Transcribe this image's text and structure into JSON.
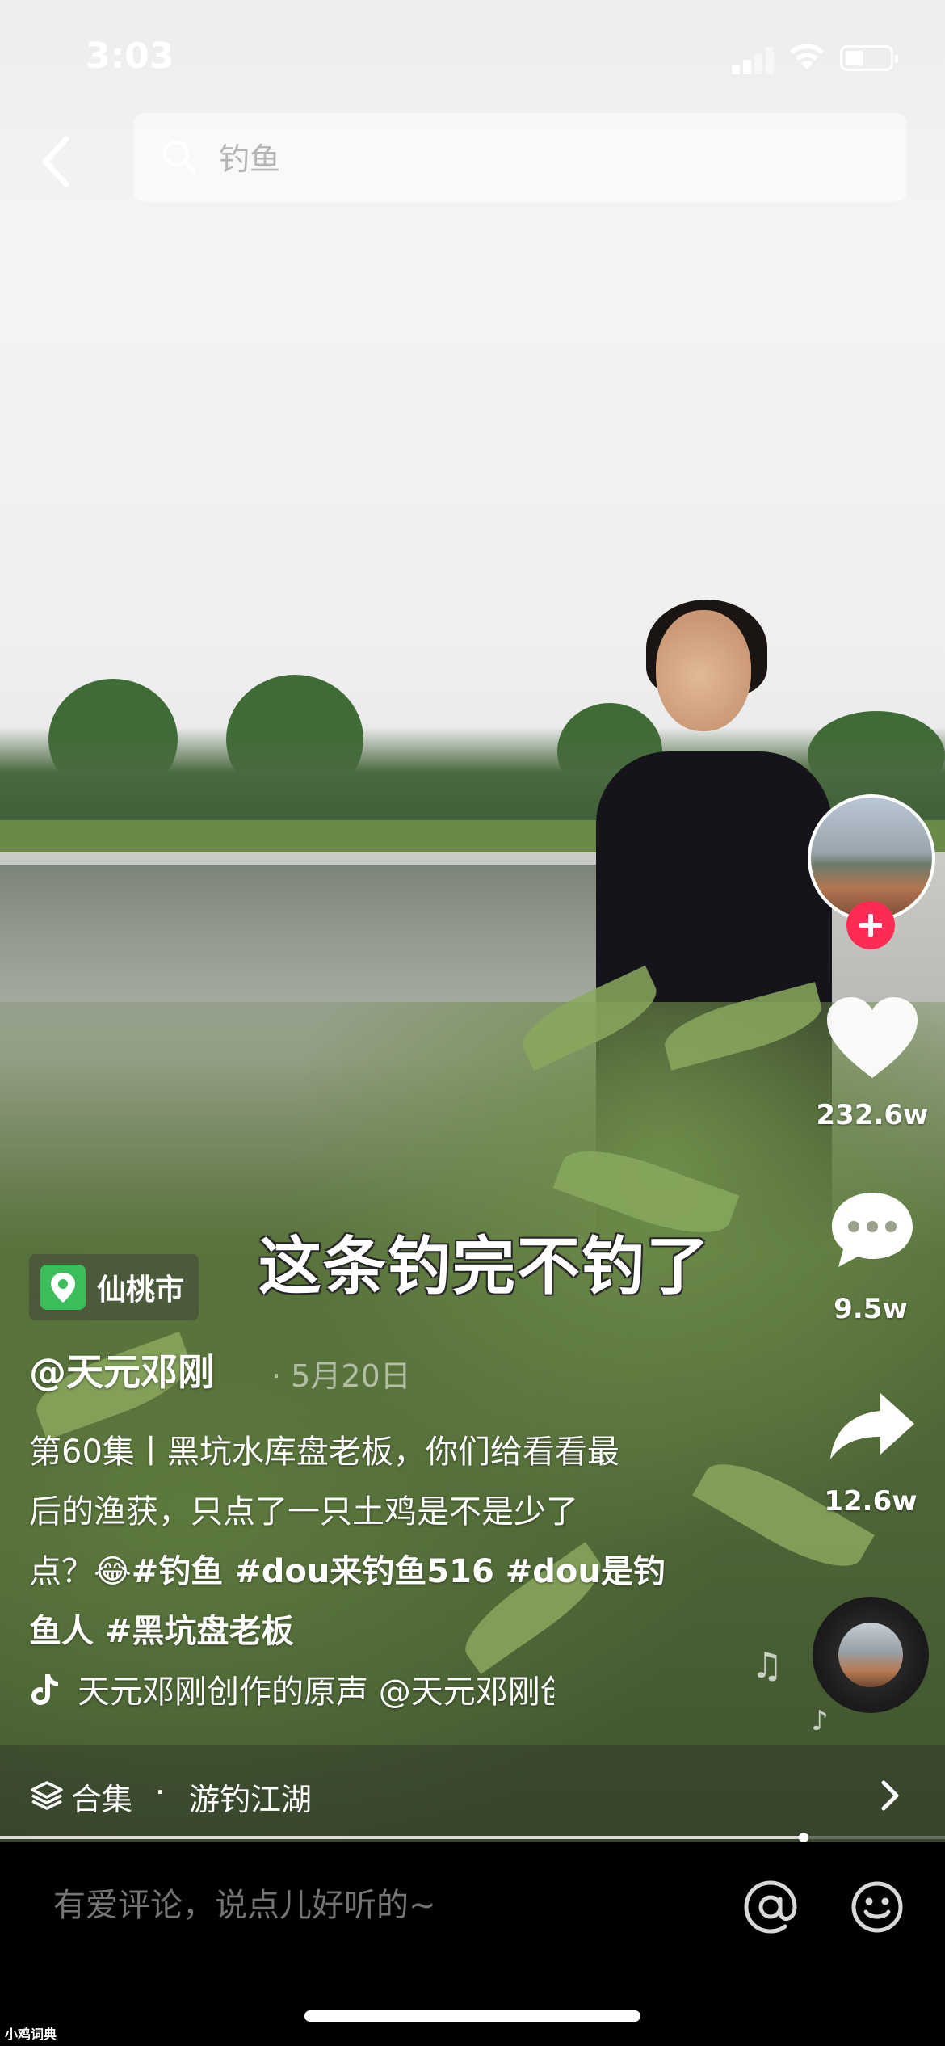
{
  "status_bar": {
    "time": "3:03"
  },
  "search": {
    "query": "钓鱼"
  },
  "video": {
    "subtitle": "这条钓完不钓了",
    "location": "仙桃市",
    "author": "@天元邓刚",
    "date": "· 5月20日",
    "description": {
      "line1": "第60集丨黑坑水库盘老板，你们给看看最",
      "line2": "后的渔获，只点了一只土鸡是不是少了",
      "line3_prefix": "点？",
      "line3_emoji": "😂",
      "line3_tags": "#钓鱼  #dou来钓鱼516 #dou是钓",
      "line4": "鱼人 #黑坑盘老板"
    },
    "music": "天元邓刚创作的原声    @天元邓刚创作的原声",
    "progress_fraction": 0.85
  },
  "rail": {
    "likes": "232.6w",
    "comments": "9.5w",
    "shares": "12.6w",
    "icons": [
      "avatar",
      "follow-plus-icon",
      "heart-icon",
      "comment-icon",
      "share-icon",
      "music-disc-icon"
    ]
  },
  "collection": {
    "label": "合集",
    "separator": "·",
    "name": "游钓江湖"
  },
  "comment_bar": {
    "placeholder": "有爱评论，说点儿好听的~"
  },
  "watermark": "小鸡词典",
  "colors": {
    "accent": "#fe2c55",
    "location_pin": "#3bbd5c"
  }
}
